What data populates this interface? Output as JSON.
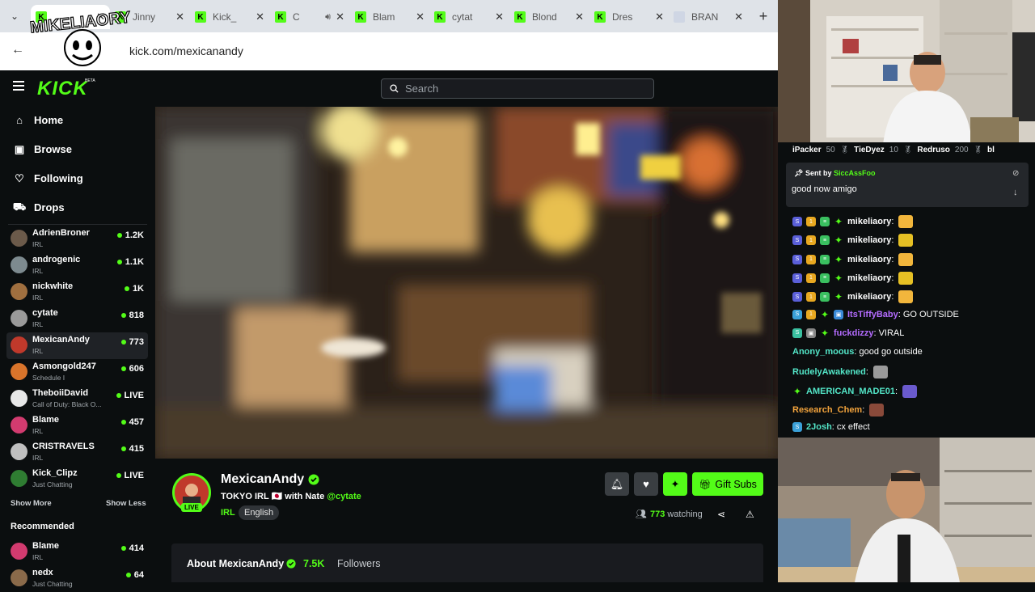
{
  "browser": {
    "tabs": [
      {
        "label": ""
      },
      {
        "label": "Jinny"
      },
      {
        "label": "Kick_"
      },
      {
        "label": "C"
      },
      {
        "label": "Blam"
      },
      {
        "label": "cytat"
      },
      {
        "label": "Blond"
      },
      {
        "label": "Dres"
      },
      {
        "label": "BRAN"
      }
    ],
    "url": "kick.com/mexicanandy"
  },
  "overlay": {
    "logo_text": "MIKELIAORY"
  },
  "header": {
    "logo": "KICK",
    "beta": "BETA",
    "search_placeholder": "Search"
  },
  "sidebar": {
    "nav": [
      {
        "label": "Home",
        "icon": "home-icon"
      },
      {
        "label": "Browse",
        "icon": "browse-icon"
      },
      {
        "label": "Following",
        "icon": "heart-icon"
      },
      {
        "label": "Drops",
        "icon": "drops-icon"
      }
    ],
    "channels": [
      {
        "name": "AdrienBroner",
        "category": "IRL",
        "viewers": "1.2K",
        "color": "#6b5a4a"
      },
      {
        "name": "androgenic",
        "category": "IRL",
        "viewers": "1.1K",
        "color": "#7d8a8f"
      },
      {
        "name": "nickwhite",
        "category": "IRL",
        "viewers": "1K",
        "color": "#a06f3f"
      },
      {
        "name": "cytate",
        "category": "IRL",
        "viewers": "818",
        "color": "#9a9a9a"
      },
      {
        "name": "MexicanAndy",
        "category": "IRL",
        "viewers": "773",
        "color": "#c0392b"
      },
      {
        "name": "Asmongold247",
        "category": "Schedule I",
        "viewers": "606",
        "color": "#d9742b"
      },
      {
        "name": "TheboiiDavid",
        "category": "Call of Duty: Black O...",
        "viewers": "LIVE",
        "color": "#e8e8e8"
      },
      {
        "name": "Blame",
        "category": "IRL",
        "viewers": "457",
        "color": "#d23b6f"
      },
      {
        "name": "CRISTRAVELS",
        "category": "IRL",
        "viewers": "415",
        "color": "#bfbfbf"
      },
      {
        "name": "Kick_Clipz",
        "category": "Just Chatting",
        "viewers": "LIVE",
        "color": "#2f7d32"
      }
    ],
    "show_more": "Show More",
    "show_less": "Show Less",
    "recommended_title": "Recommended",
    "recommended": [
      {
        "name": "Blame",
        "category": "IRL",
        "viewers": "414",
        "color": "#d23b6f"
      },
      {
        "name": "nedx",
        "category": "Just Chatting",
        "viewers": "64",
        "color": "#8a6a4a"
      }
    ]
  },
  "channel": {
    "name": "MexicanAndy",
    "live": "LIVE",
    "title_prefix": "TOKYO IRL 🇯🇵 with Nate",
    "title_mention": "@cytate",
    "category": "IRL",
    "language": "English",
    "gift_label": "Gift Subs",
    "viewers": "773",
    "watching_label": "watching",
    "about_title": "About MexicanAndy",
    "followers_count": "7.5K",
    "followers_label": "Followers"
  },
  "chat": {
    "gifters": [
      {
        "name": "iPacker",
        "count": "50"
      },
      {
        "name": "TieDyez",
        "count": "10"
      },
      {
        "name": "Redruso",
        "count": "200"
      },
      {
        "name": "bl",
        "count": ""
      }
    ],
    "pinned": {
      "sent_by": "Sent by",
      "user": "SiccAssFoo",
      "message": "good now amigo"
    },
    "messages": [
      {
        "user": "mikeliaory",
        "text": "",
        "color": "#ffffff",
        "emote": "#f2b63c"
      },
      {
        "user": "mikeliaory",
        "text": "",
        "color": "#ffffff",
        "emote": "#e6c024"
      },
      {
        "user": "mikeliaory",
        "text": "",
        "color": "#ffffff",
        "emote": "#f2b63c"
      },
      {
        "user": "mikeliaory",
        "text": "",
        "color": "#ffffff",
        "emote": "#e6c024"
      },
      {
        "user": "mikeliaory",
        "text": "",
        "color": "#ffffff",
        "emote": "#f2b63c"
      },
      {
        "user": "ItsTiffyBaby",
        "text": "GO OUTSIDE",
        "color": "#b46cff",
        "emote": ""
      },
      {
        "user": "fuckdizzy",
        "text": "VIRAL",
        "color": "#b46cff",
        "emote": ""
      },
      {
        "user": "Anony_moous",
        "text": "good go outside",
        "color": "#53e6c8",
        "emote": ""
      },
      {
        "user": "RudelyAwakened",
        "text": "",
        "color": "#53e6c8",
        "emote": "#9a9a9a"
      },
      {
        "user": "AMERICAN_MADE01",
        "text": "",
        "color": "#53e6c8",
        "emote": "#6a5acd"
      },
      {
        "user": "Research_Chem",
        "text": "",
        "color": "#f2a33c",
        "emote": "#8a4a3a"
      },
      {
        "user": "2Josh",
        "text": "cx effect",
        "color": "#53e6c8",
        "emote": ""
      }
    ]
  },
  "colors": {
    "accent": "#53fc18",
    "bg": "#0b0e0f",
    "panel": "#191b1f"
  }
}
